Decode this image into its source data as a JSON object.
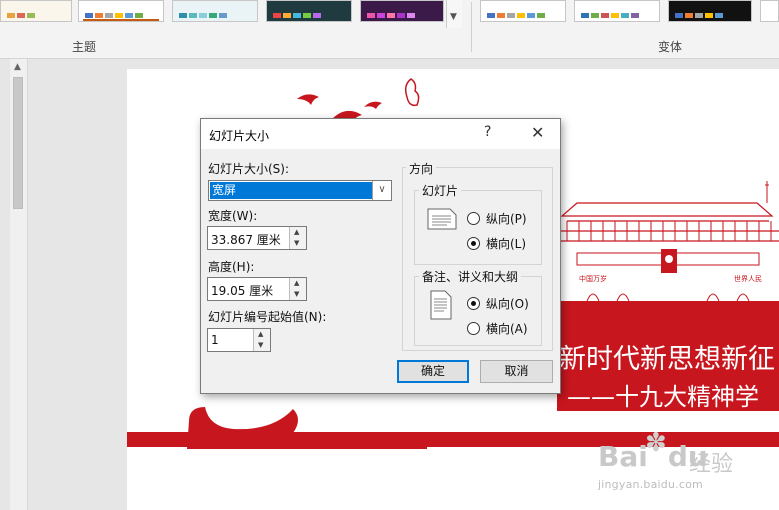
{
  "ribbon": {
    "themes_label": "主题",
    "variants_label": "变体"
  },
  "slide": {
    "headline": "新时代新思想新征",
    "subline": "——十九大精神学",
    "banner_left": "中国万岁",
    "banner_right": "世界人民"
  },
  "dialog": {
    "title": "幻灯片大小",
    "help": "?",
    "close": "✕",
    "size_label": "幻灯片大小(S):",
    "size_value": "宽屏",
    "width_label": "宽度(W):",
    "width_value": "33.867 厘米",
    "height_label": "高度(H):",
    "height_value": "19.05 厘米",
    "start_label": "幻灯片编号起始值(N):",
    "start_value": "1",
    "orientation_label": "方向",
    "slides_group_label": "幻灯片",
    "slides_portrait": "纵向(P)",
    "slides_landscape": "横向(L)",
    "slides_selected": "landscape",
    "notes_group_label": "备注、讲义和大纲",
    "notes_portrait": "纵向(O)",
    "notes_landscape": "横向(A)",
    "notes_selected": "portrait",
    "ok": "确定",
    "cancel": "取消"
  },
  "watermark": {
    "logo": "Bai",
    "logo2": "du",
    "jingyan": "经验",
    "url": "jingyan.baidu.com"
  },
  "colors": {
    "accent": "#0078d7",
    "slide_red": "#c8161e"
  }
}
